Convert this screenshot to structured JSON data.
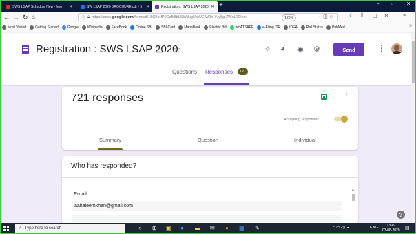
{
  "browser": {
    "tabs": [
      {
        "label": "SWS LSAP Schedule New - [em",
        "color": "#d93025"
      },
      {
        "label": "SW LSAP 2020 BROCHURE.cdr - 5_",
        "color": "#1a73e8"
      },
      {
        "label": "Registration : SWS LSAP 2020",
        "color": "#673ab7"
      }
    ],
    "new_tab": "+",
    "window_controls": [
      "–",
      "▫",
      "✕"
    ],
    "url_prefix": "https://docs.",
    "url_domain": "google.com",
    "url_rest": "/forms/d/15Q3b-fP0Cxfk5bLSWdugUjwUEjW9h-Yvy5g-ZWnL70/edit",
    "zoom": "120%",
    "bookmarks": [
      {
        "label": "Most Visited",
        "color": "#666666"
      },
      {
        "label": "Getting Started",
        "color": "#666666"
      },
      {
        "label": "Google",
        "color": "#4285f4"
      },
      {
        "label": "Wikipedia",
        "color": "#666666"
      },
      {
        "label": "FaceBook",
        "color": "#666666"
      },
      {
        "label": "Online SBI",
        "color": "#1a73e8"
      },
      {
        "label": "SBI Card",
        "color": "#666666"
      },
      {
        "label": "MahaBank",
        "color": "#666666"
      },
      {
        "label": "Electric Bill",
        "color": "#666666"
      },
      {
        "label": "wHATSAPP",
        "color": "#25d366"
      },
      {
        "label": "e-Filing ITR",
        "color": "#1a73e8"
      },
      {
        "label": "IDEA",
        "color": "#666666"
      },
      {
        "label": "Rail Status",
        "color": "#666666"
      },
      {
        "label": "PubMed",
        "color": "#666666"
      }
    ]
  },
  "form": {
    "title": "Registration : SWS LSAP 2020",
    "send_label": "Send",
    "tabs": {
      "questions": "Questions",
      "responses": "Responses",
      "badge": "721"
    }
  },
  "responses": {
    "count_title": "721 responses",
    "accepting_label": "Accepting responses",
    "accepting": true,
    "subtabs": [
      "Summary",
      "Question",
      "Individual"
    ],
    "who_title": "Who has responded?",
    "email_label": "Email",
    "emails": [
      "aahaleemkhan@gmail.com"
    ]
  },
  "taskbar": {
    "search_placeholder": "Type here to search",
    "lang": "ENG",
    "time": "13:49",
    "date": "03-08-2020"
  },
  "colors": {
    "accent": "#673ab7",
    "background": "#f0ebf8",
    "toggle": "#c8a83a"
  }
}
